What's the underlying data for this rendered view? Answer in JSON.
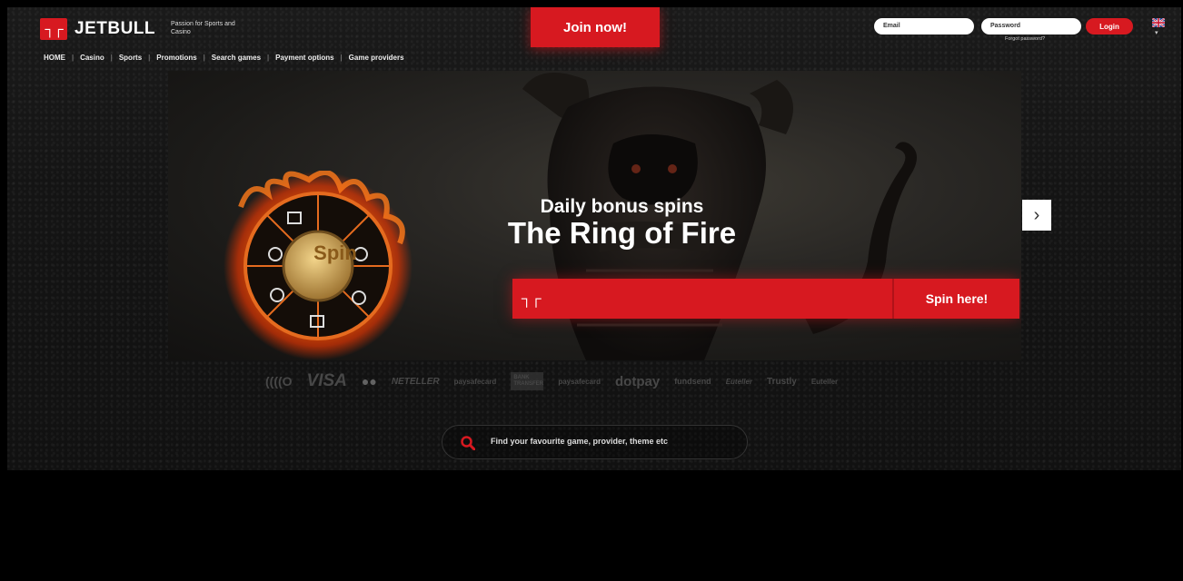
{
  "header": {
    "logo_mark": "┐┌",
    "brand": "JETBULL",
    "tagline": "Passion for Sports and Casino",
    "join_label": "Join now!",
    "email_placeholder": "Email",
    "password_placeholder": "Password",
    "forgot_label": "Forgot password?",
    "login_label": "Login",
    "language_icon": "uk-flag-icon"
  },
  "nav": {
    "items": [
      "HOME",
      "Casino",
      "Sports",
      "Promotions",
      "Search games",
      "Payment options",
      "Game providers"
    ],
    "separator": "|"
  },
  "banner": {
    "wheel_label": "Spin",
    "subtitle": "Daily bonus spins",
    "title": "The Ring of Fire",
    "spin_label": "Spin here!",
    "next_icon": "chevron-right-icon",
    "next_glyph": "›"
  },
  "payments": [
    "((((O",
    "VISA",
    "●●",
    "NETELLER",
    "paysafecard",
    "BANK TRANSFER",
    "paysafecard",
    "dotpay",
    "fundsend",
    "Euteller",
    "Trustly",
    "Euteller"
  ],
  "search": {
    "placeholder": "Find your favourite game, provider, theme etc"
  },
  "colors": {
    "accent": "#d71920",
    "background": "#141414"
  }
}
